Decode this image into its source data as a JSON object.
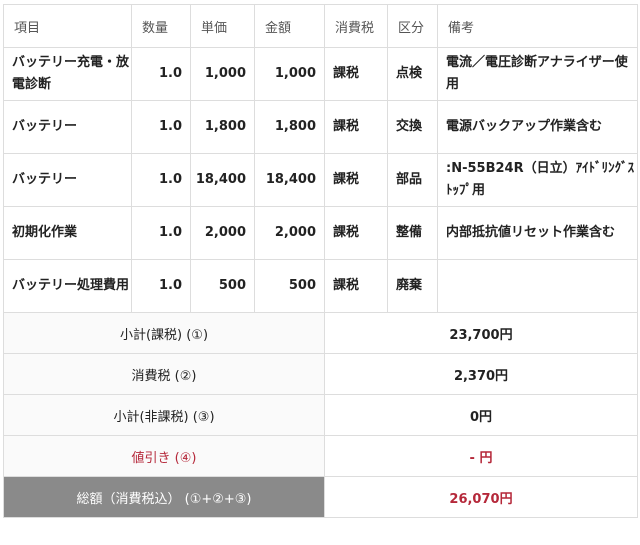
{
  "header": {
    "item": "項目",
    "qty": "数量",
    "unit_price": "単価",
    "amount": "金額",
    "tax": "消費税",
    "category": "区分",
    "note": "備考"
  },
  "rows": [
    {
      "item": "バッテリー充電・放電診断",
      "qty": "1.0",
      "unit_price": "1,000",
      "amount": "1,000",
      "tax": "課税",
      "category": "点検",
      "note": "電流／電圧診断アナライザー使用"
    },
    {
      "item": "バッテリー",
      "qty": "1.0",
      "unit_price": "1,800",
      "amount": "1,800",
      "tax": "課税",
      "category": "交換",
      "note": "電源バックアップ作業含む"
    },
    {
      "item": "バッテリー",
      "qty": "1.0",
      "unit_price": "18,400",
      "amount": "18,400",
      "tax": "課税",
      "category": "部品",
      "note": ":N-55B24R（日立）ｱｲﾄﾞﾘﾝｸﾞｽﾄｯﾌﾟ用"
    },
    {
      "item": "初期化作業",
      "qty": "1.0",
      "unit_price": "2,000",
      "amount": "2,000",
      "tax": "課税",
      "category": "整備",
      "note": "内部抵抗値リセット作業含む"
    },
    {
      "item": "バッテリー処理費用",
      "qty": "1.0",
      "unit_price": "500",
      "amount": "500",
      "tax": "課税",
      "category": "廃棄",
      "note": ""
    }
  ],
  "summary": {
    "subtotal_taxable": {
      "label": "小計(課税) (①)",
      "value": "23,700円"
    },
    "consumption_tax": {
      "label": "消費税 (②)",
      "value": "2,370円"
    },
    "subtotal_nontaxable": {
      "label": "小計(非課税) (③)",
      "value": "0円"
    },
    "discount": {
      "label": "値引き (④)",
      "value": "- 円"
    },
    "total": {
      "label": "総額（消費税込） (①+②+③)",
      "value": "26,070円"
    }
  },
  "colors": {
    "accent_red": "#b5283a",
    "total_label_bg": "#8a8a8a",
    "summary_label_bg": "#fafafa",
    "border": "#dddddd"
  }
}
